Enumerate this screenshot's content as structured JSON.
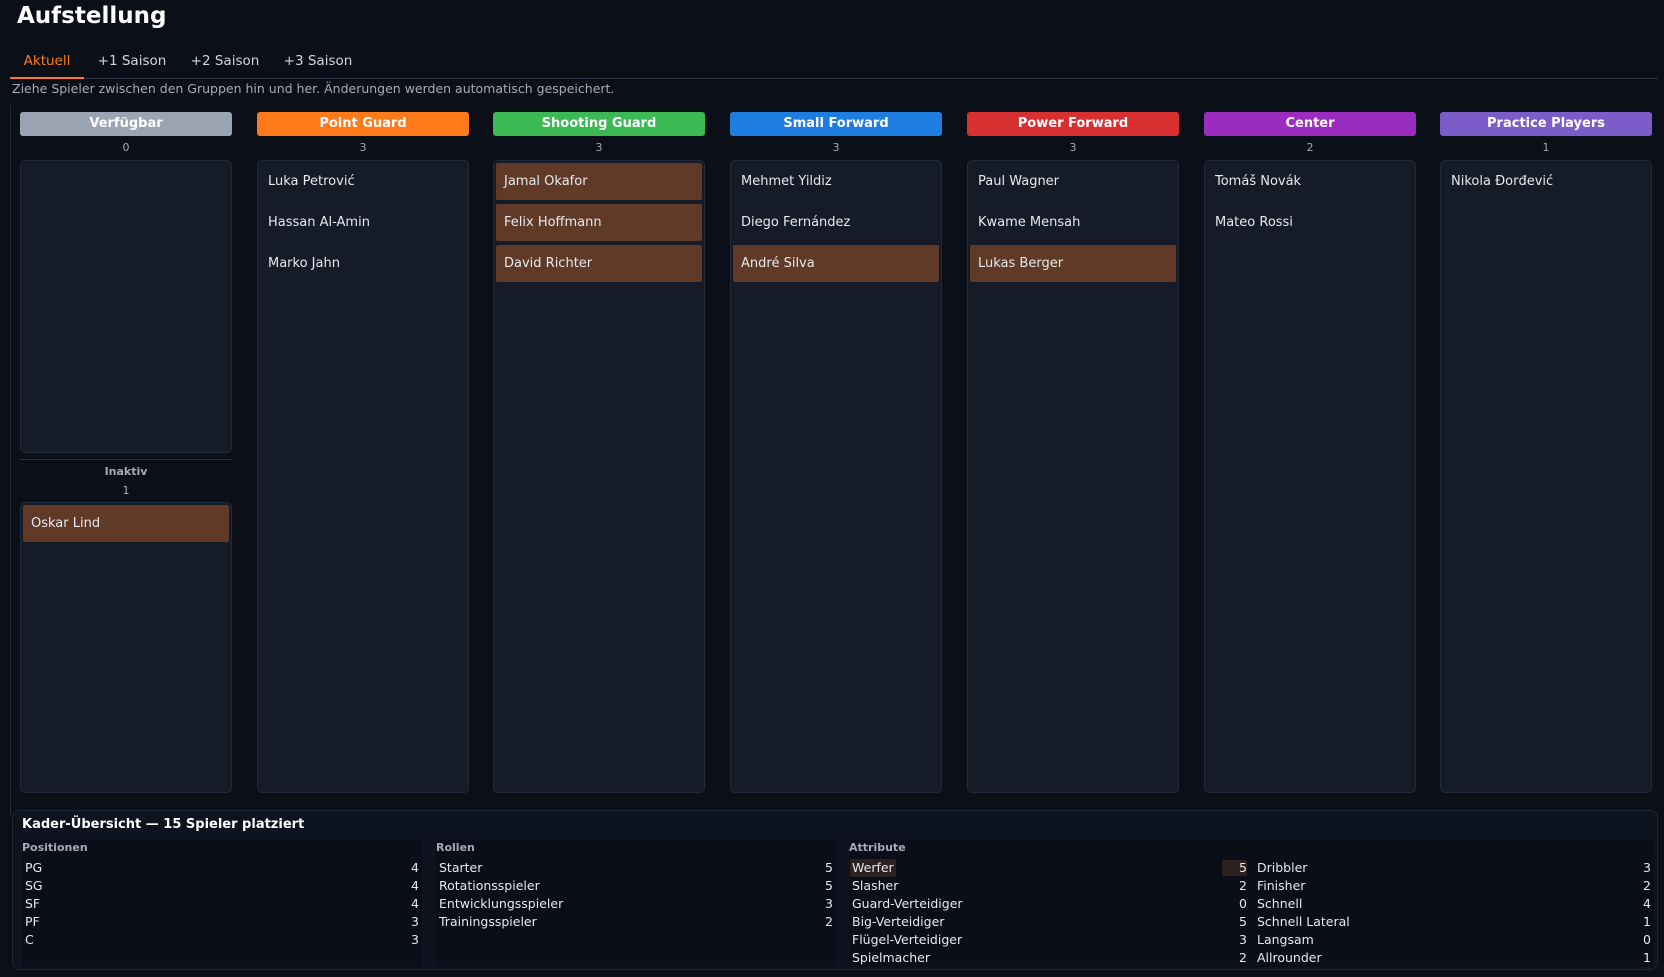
{
  "page": {
    "title": "Aufstellung",
    "hint": "Ziehe Spieler zwischen den Gruppen hin und her. Änderungen werden automatisch gespeichert."
  },
  "tabs": [
    {
      "label": "Aktuell",
      "active": true
    },
    {
      "label": "+1 Saison",
      "active": false
    },
    {
      "label": "+2 Saison",
      "active": false
    },
    {
      "label": "+3 Saison",
      "active": false
    }
  ],
  "columns": [
    {
      "name": "Verfügbar",
      "color": "#9aa4b3",
      "count": "0",
      "players": []
    },
    {
      "name": "Point Guard",
      "color": "#ff7a1a",
      "count": "3",
      "players": [
        {
          "name": "Luka Petrović",
          "flag": false
        },
        {
          "name": "Hassan Al-Amin",
          "flag": false
        },
        {
          "name": "Marko Jahn",
          "flag": false
        }
      ]
    },
    {
      "name": "Shooting Guard",
      "color": "#3cb855",
      "count": "3",
      "players": [
        {
          "name": "Jamal Okafor",
          "flag": true
        },
        {
          "name": "Felix Hoffmann",
          "flag": true
        },
        {
          "name": "David Richter",
          "flag": true
        }
      ]
    },
    {
      "name": "Small Forward",
      "color": "#1e7de0",
      "count": "3",
      "players": [
        {
          "name": "Mehmet Yildiz",
          "flag": false
        },
        {
          "name": "Diego Fernández",
          "flag": false
        },
        {
          "name": "André Silva",
          "flag": true
        }
      ]
    },
    {
      "name": "Power Forward",
      "color": "#d83030",
      "count": "3",
      "players": [
        {
          "name": "Paul Wagner",
          "flag": false
        },
        {
          "name": "Kwame Mensah",
          "flag": false
        },
        {
          "name": "Lukas Berger",
          "flag": true
        }
      ]
    },
    {
      "name": "Center",
      "color": "#9b2cc0",
      "count": "2",
      "players": [
        {
          "name": "Tomáš Novák",
          "flag": false
        },
        {
          "name": "Mateo Rossi",
          "flag": false
        }
      ]
    },
    {
      "name": "Practice Players",
      "color": "#7b5cc8",
      "count": "1",
      "players": [
        {
          "name": "Nikola Đorđević",
          "flag": false
        }
      ]
    }
  ],
  "inactive": {
    "label": "Inaktiv",
    "count": "1",
    "players": [
      {
        "name": "Oskar Lind",
        "flag": true
      }
    ]
  },
  "summary": {
    "title": "Kader-Übersicht — 15 Spieler platziert",
    "positions": {
      "label": "Positionen",
      "rows": [
        {
          "label": "PG",
          "value": "4"
        },
        {
          "label": "SG",
          "value": "4"
        },
        {
          "label": "SF",
          "value": "4"
        },
        {
          "label": "PF",
          "value": "3"
        },
        {
          "label": "C",
          "value": "3"
        }
      ]
    },
    "roles": {
      "label": "Rollen",
      "rows": [
        {
          "label": "Starter",
          "value": "5"
        },
        {
          "label": "Rotationsspieler",
          "value": "5"
        },
        {
          "label": "Entwicklungsspieler",
          "value": "3"
        },
        {
          "label": "Trainingsspieler",
          "value": "2"
        }
      ]
    },
    "attributes": {
      "label": "Attribute",
      "left": [
        {
          "label": "Werfer",
          "value": "5"
        },
        {
          "label": "Slasher",
          "value": "2"
        },
        {
          "label": "Guard-Verteidiger",
          "value": "0"
        },
        {
          "label": "Big-Verteidiger",
          "value": "5"
        },
        {
          "label": "Flügel-Verteidiger",
          "value": "3"
        },
        {
          "label": "Spielmacher",
          "value": "2"
        }
      ],
      "right": [
        {
          "label": "Dribbler",
          "value": "3"
        },
        {
          "label": "Finisher",
          "value": "2"
        },
        {
          "label": "Schnell",
          "value": "4"
        },
        {
          "label": "Schnell Lateral",
          "value": "1"
        },
        {
          "label": "Langsam",
          "value": "0"
        },
        {
          "label": "Allrounder",
          "value": "1"
        }
      ]
    }
  }
}
